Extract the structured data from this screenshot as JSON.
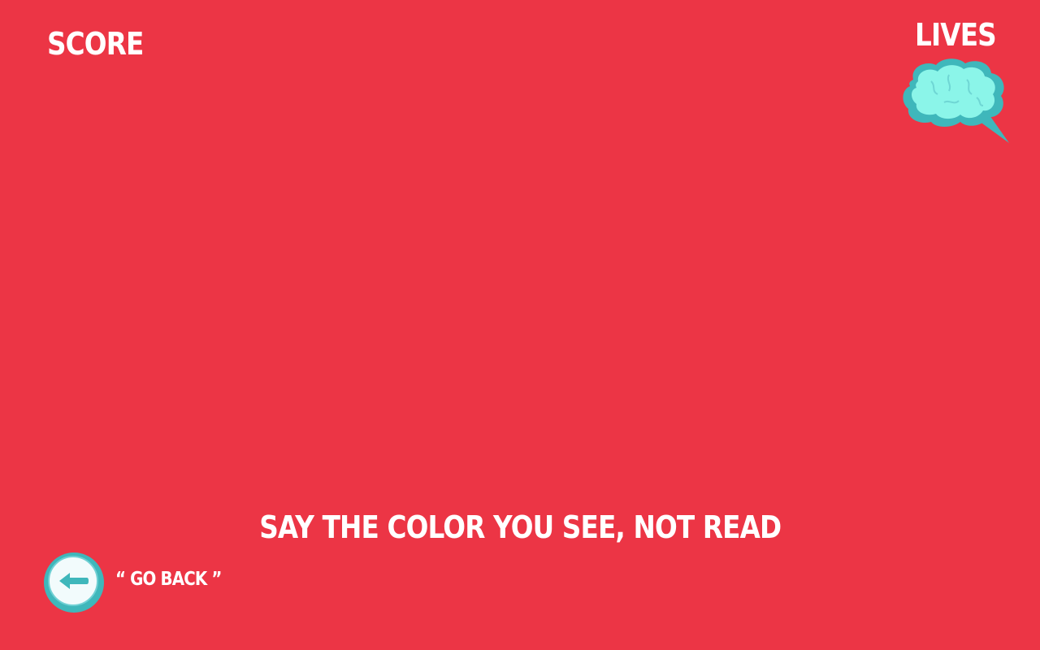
{
  "hud": {
    "score_label": "SCORE",
    "lives_label": "LIVES",
    "lives_icon": "brain-icon"
  },
  "instruction": {
    "text": "SAY THE COLOR YOU SEE, NOT READ"
  },
  "back": {
    "icon": "back-arrow-icon",
    "label": "“ GO BACK ”"
  },
  "colors": {
    "background": "#ec3545",
    "text": "#ffffff",
    "brain_fill": "#8bf5e9",
    "brain_outline": "#3fb7bb",
    "button_ring": "#3fb7bb",
    "button_face": "#f2fbfc"
  }
}
